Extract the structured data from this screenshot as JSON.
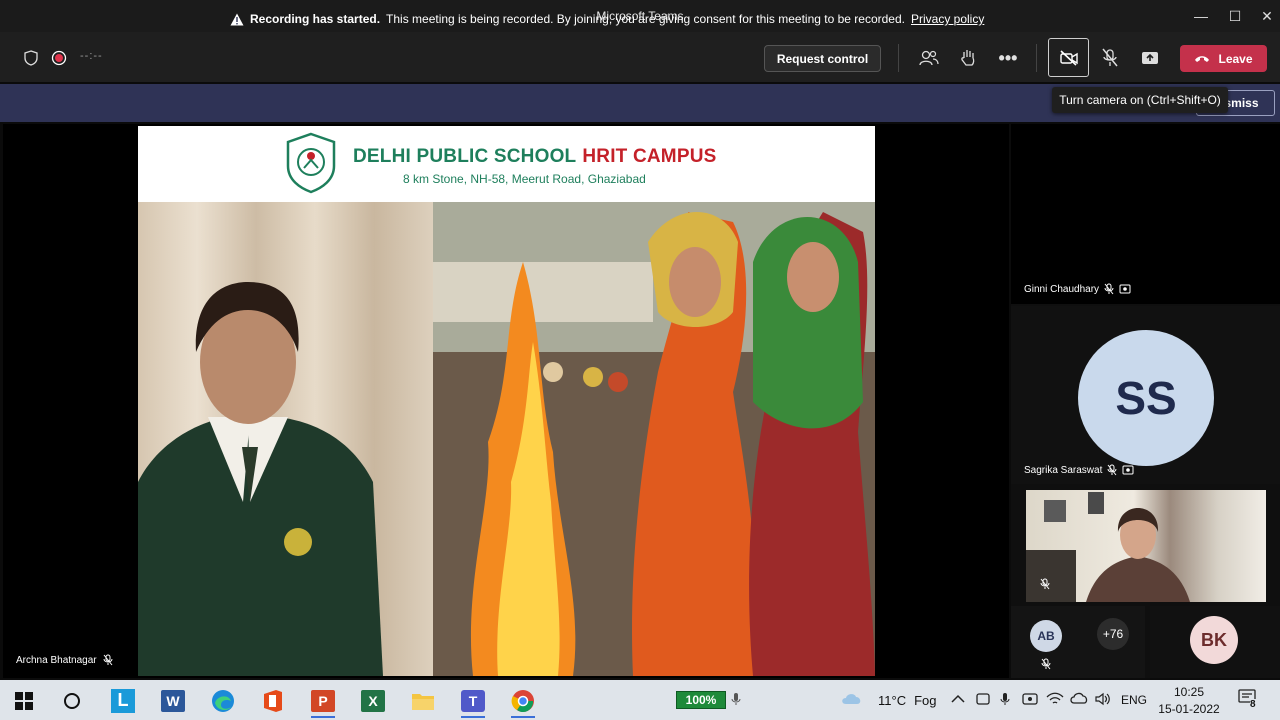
{
  "window": {
    "title": "Microsoft Teams",
    "minimize": "—",
    "maximize": "☐",
    "close": "✕"
  },
  "toolbar": {
    "timer": "--:--",
    "request_control_label": "Request control",
    "leave_label": "Leave"
  },
  "banner": {
    "title": "Recording has started.",
    "message": "This meeting is being recorded. By joining, you are giving consent for this meeting to be recorded.",
    "link": "Privacy policy",
    "dismiss_label": "Dismiss"
  },
  "tooltip": {
    "text": "Turn camera on (Ctrl+Shift+O)"
  },
  "slide": {
    "school_name_1": "DELHI PUBLIC SCHOOL",
    "school_name_2": "HRIT CAMPUS",
    "address": "8 km Stone, NH-58, Meerut Road, Ghaziabad"
  },
  "participants": {
    "main_speaker": "Archna Bhatnagar",
    "tile1_name": "Ginni Chaudhary",
    "tile2_initials": "SS",
    "tile2_name": "Sagrika Saraswat",
    "tile4_avatar1": "AB",
    "tile4_overflow": "+76",
    "tile5_initials": "BK"
  },
  "taskbar": {
    "zoom": "100%",
    "weather_temp": "11°C",
    "weather_desc": "Fog",
    "lang": "ENG",
    "time": "10:25",
    "date": "15-01-2022",
    "notifications": "8"
  },
  "colors": {
    "leave": "#c4314b",
    "banner": "#2f3356",
    "school_green": "#1e7f5c",
    "school_red": "#c42129"
  }
}
